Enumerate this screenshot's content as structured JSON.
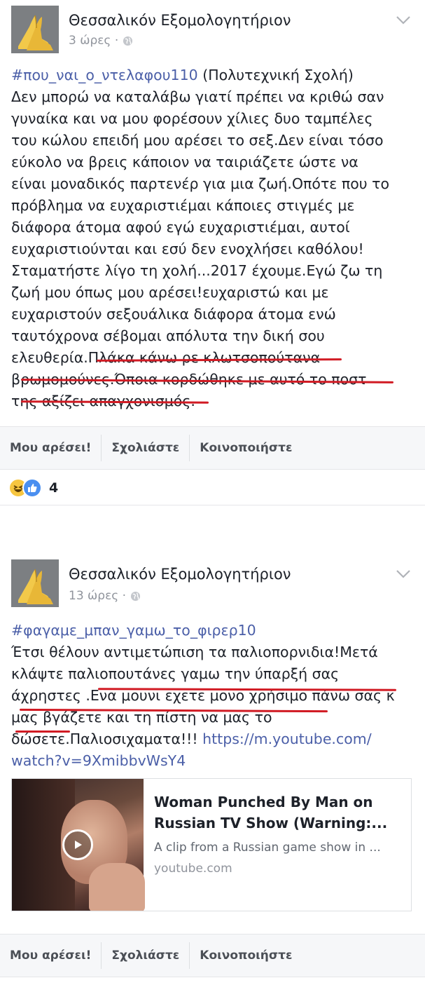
{
  "post1": {
    "page_name": "Θεσσαλικόν Εξομολογητήριον",
    "time": "3 ώρες ·",
    "lines": [
      {
        "hashtag": "#που_ναι_ο_ντελαφου110",
        "text": " (Πολυτεχνική Σχολή)"
      },
      {
        "text": "Δεν μπορώ να καταλάβω γιατί πρέπει να κριθώ σαν"
      },
      {
        "text": "γυναίκα και να μου φορέσουν χίλιες δυο ταμπέλες"
      },
      {
        "text": "του κώλου επειδή μου αρέσει το σεξ.Δεν είναι τόσο"
      },
      {
        "text": "εύκολο να βρεις κάποιον να ταιριάζετε ώστε να"
      },
      {
        "text": "είναι μοναδικός παρτενέρ για μια ζωή.Οπότε που το"
      },
      {
        "text": "πρόβλημα να ευχαριστιέμαι κάποιες στιγμές με"
      },
      {
        "text": "διάφορα άτομα αφού εγώ ευχαριστιέμαι, αυτοί"
      },
      {
        "text": "ευχαριστιούνται και εσύ δεν ενοχλήσει καθόλου!"
      },
      {
        "text": "Σταματήστε λίγο τη χολή...2017 έχουμε.Εγώ ζω τη"
      },
      {
        "text": "ζωή μου όπως μου αρέσει!ευχαριστώ και με"
      },
      {
        "text": "ευχαριστούν σεξουάλικα διάφορα άτομα ενώ"
      },
      {
        "text": "ταυτόχρονα σέβομαι απόλυτα την δική σου"
      },
      {
        "text": "ελευθερία.Πλάκα κάνω ρε κλωτσοπούτανα"
      },
      {
        "text": "βρωμομούνες.Όποια κορδώθηκε με αυτό το ποστ"
      },
      {
        "text": "της αξίζει απαγχονισμός."
      }
    ],
    "actions": {
      "like": "Μου αρέσει!",
      "comment": "Σχολιάστε",
      "share": "Κοινοποιήστε"
    },
    "reaction_count": "4",
    "reaction_icons": [
      "haha-icon",
      "like-icon"
    ]
  },
  "post2": {
    "page_name": "Θεσσαλικόν Εξομολογητήριον",
    "time": "13 ώρες ·",
    "lines": [
      {
        "hashtag": "#φαγαμε_μπαν_γαμω_το_φιρερ10",
        "text": ""
      },
      {
        "text": "Έτσι θέλουν αντιμετώπιση τα παλιοπορνιδια!Μετά"
      },
      {
        "text": "κλάψτε παλιοπουτάνες γαμω την ύπαρξή σας"
      },
      {
        "text": "άχρηστες .Ενα μουνι εχετε μονο χρήσιμο πάνω σας κ"
      },
      {
        "text": "μας βγάζετε και τη πίστη να μας το"
      },
      {
        "text": "δώσετε.Παλιοσιχαματα!!! ",
        "link": "https://m.youtube.com/"
      },
      {
        "link": "watch?v=9XmibbvWsY4",
        "text": ""
      }
    ],
    "card": {
      "title_line1": "Woman Punched By Man on",
      "title_line2": "Russian TV Show (Warning:...",
      "description": "A clip from a Russian game show in ...",
      "domain": "youtube.com"
    },
    "actions": {
      "like": "Μου αρέσει!",
      "comment": "Σχολιάστε",
      "share": "Κοινοποιήστε"
    }
  },
  "colors": {
    "underline": "#d11b24",
    "link": "#4b5fa8",
    "action_bar": "#f6f7f9"
  }
}
